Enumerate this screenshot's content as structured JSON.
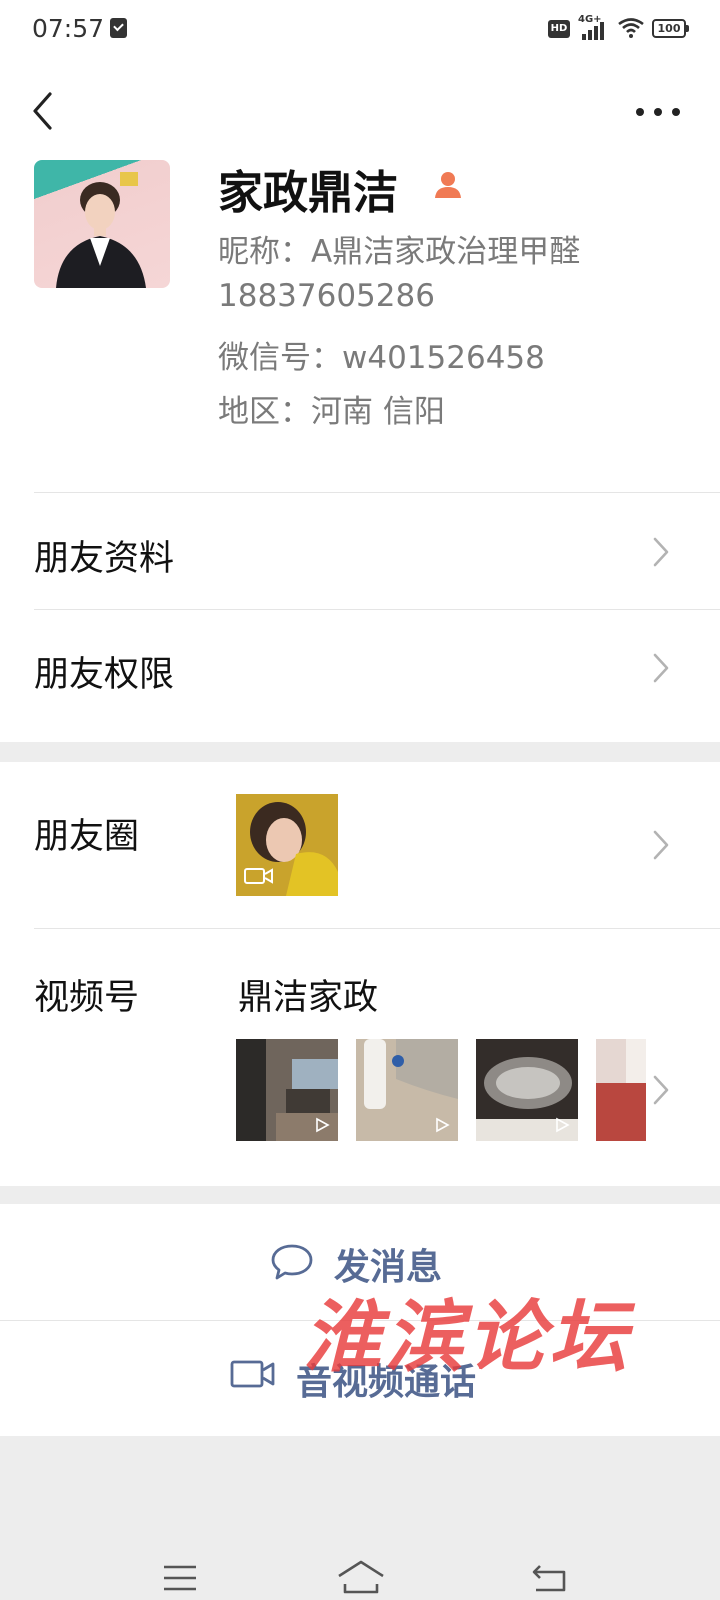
{
  "status_bar": {
    "time": "07:57",
    "hd_label": "HD",
    "network_label": "4G+",
    "battery_level": "100"
  },
  "header": {
    "back_icon": "chevron-left-icon",
    "more_icon": "more-dots-icon"
  },
  "profile": {
    "name": "家政鼎洁",
    "gender_icon": "user-silhouette-icon",
    "gender_icon_color": "#f07a54",
    "nickname_line": "昵称：A鼎洁家政治理甲醛",
    "phone_line": "18837605286",
    "wechat_id_line": "微信号：w401526458",
    "region_line": "地区：河南  信阳"
  },
  "menu": {
    "friend_profile": "朋友资料",
    "friend_permissions": "朋友权限"
  },
  "moments": {
    "label": "朋友圈",
    "channels_label": "视频号",
    "channels_name": "鼎洁家政"
  },
  "actions": {
    "message_label": "发消息",
    "call_label": "音视频通话",
    "accent_color": "#576b95"
  },
  "watermark": {
    "text": "淮滨论坛"
  }
}
